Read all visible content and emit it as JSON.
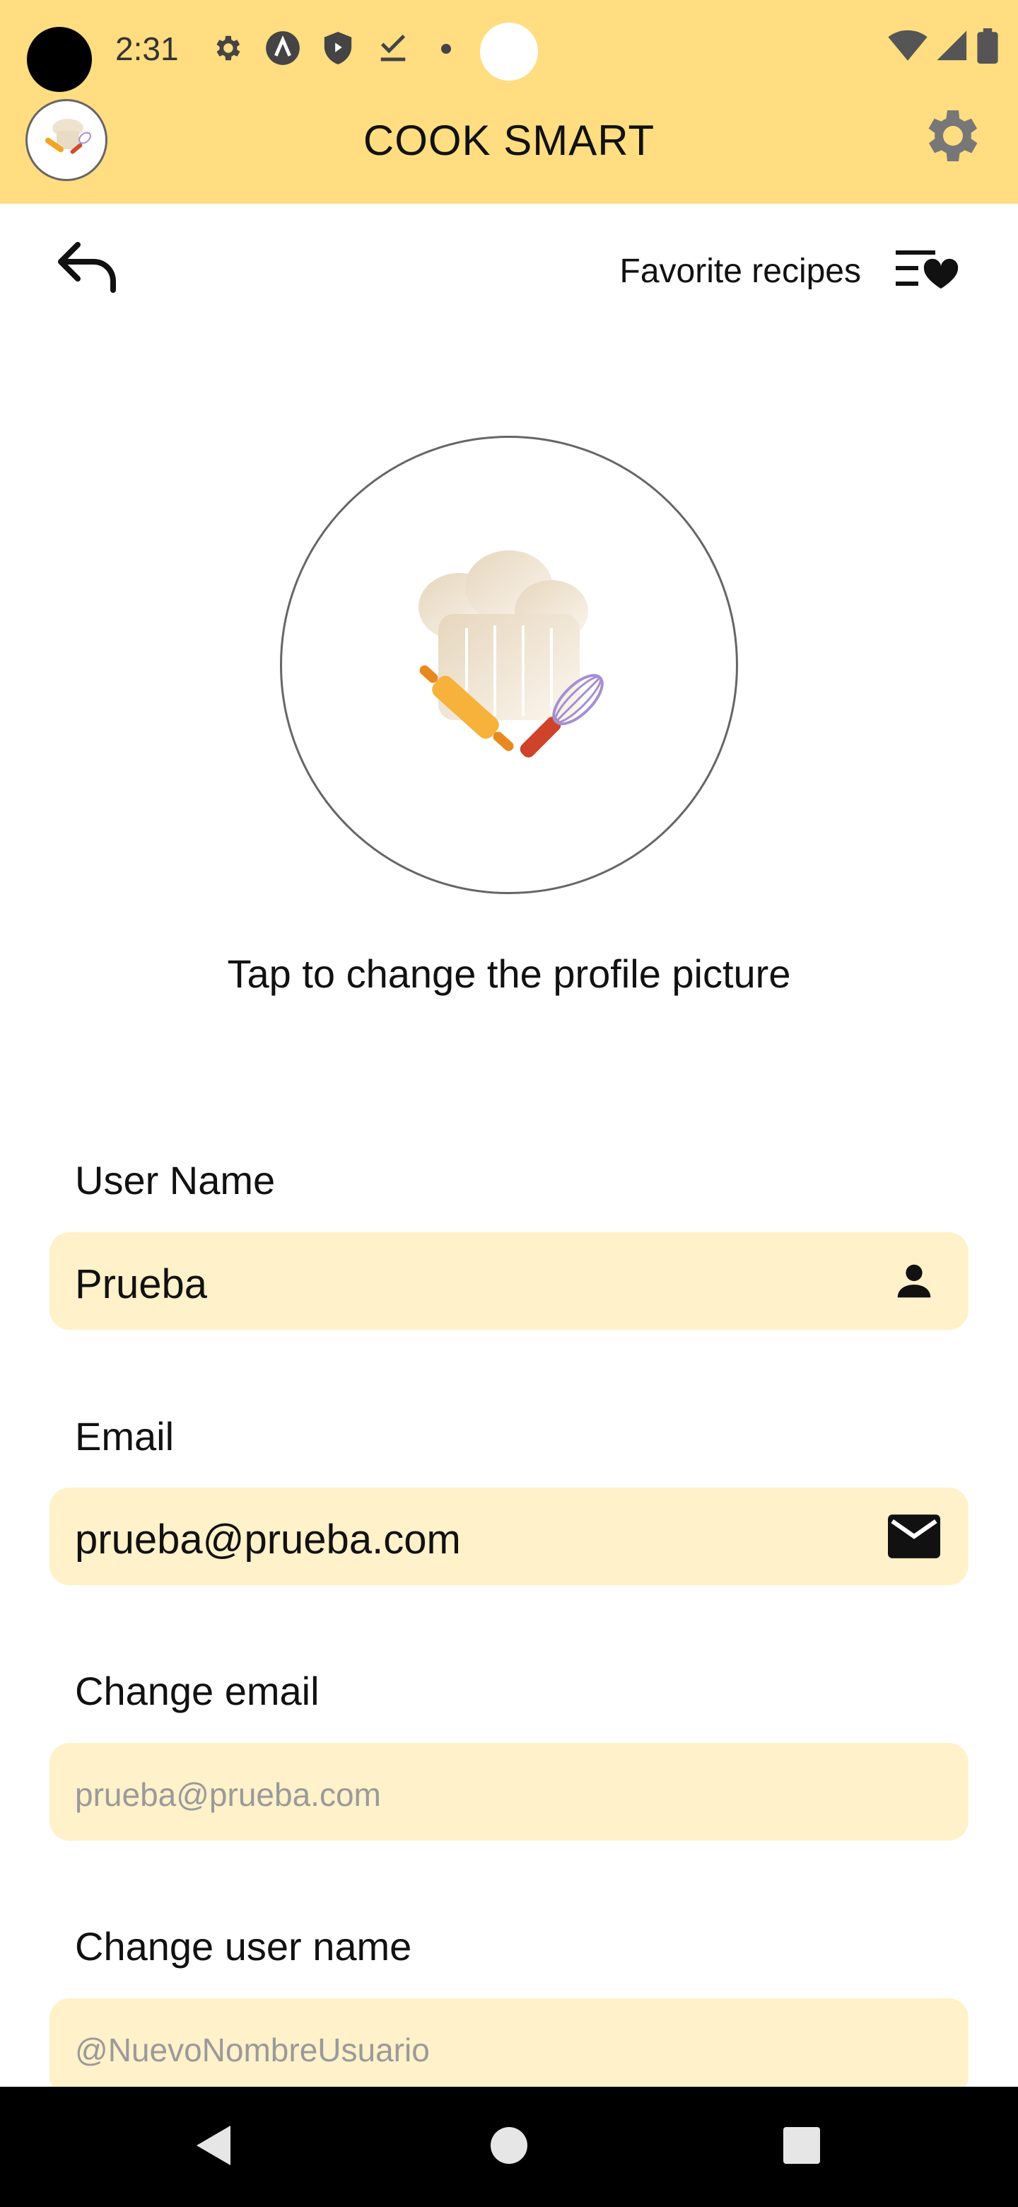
{
  "status_bar": {
    "time": "2:31",
    "icons": [
      "gear-icon",
      "a-icon",
      "shield-icon",
      "download-done-icon",
      "dot-icon",
      "wifi-icon",
      "signal-icon",
      "battery-icon"
    ]
  },
  "app_bar": {
    "title": "COOK SMART",
    "avatar_icon": "chef-logo-icon",
    "settings_icon": "gear-icon"
  },
  "toolbar": {
    "back_icon": "back-arrow-icon",
    "favorites_label": "Favorite recipes",
    "favorites_icon": "list-heart-icon"
  },
  "profile": {
    "picture_icon": "chef-hat-icon",
    "hint": "Tap to change the profile picture"
  },
  "form": {
    "user_name": {
      "label": "User Name",
      "value": "Prueba",
      "icon": "person-icon"
    },
    "email": {
      "label": "Email",
      "value": "prueba@prueba.com",
      "icon": "mail-icon"
    },
    "change_email": {
      "label": "Change email",
      "placeholder": "prueba@prueba.com"
    },
    "change_user_name": {
      "label": "Change user name",
      "placeholder": "@NuevoNombreUsuario"
    }
  },
  "colors": {
    "header": "#FFDD80",
    "field_background": "#FFF1C9",
    "navbar": "#000000"
  }
}
